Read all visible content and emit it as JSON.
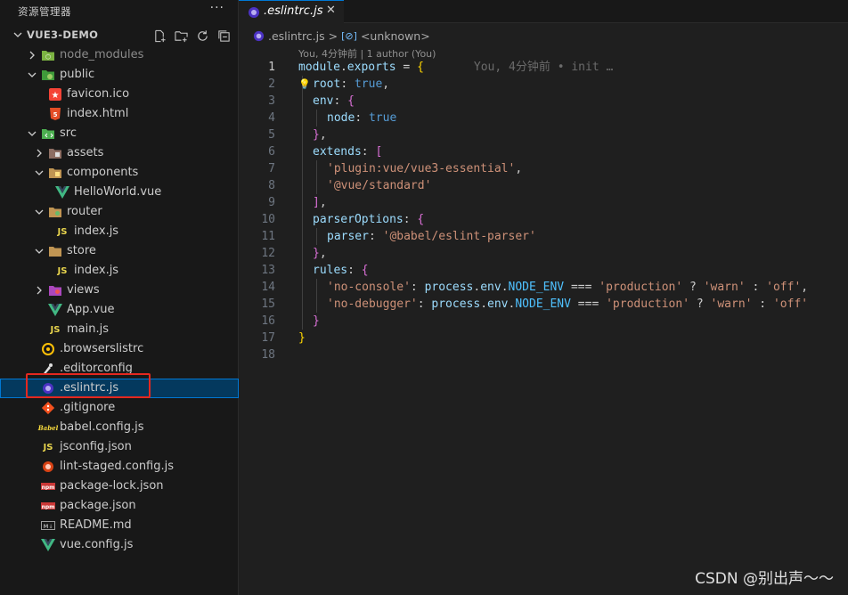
{
  "explorer": {
    "title": "资源管理器",
    "more": "···",
    "project": "VUE3-DEMO"
  },
  "tree": [
    {
      "label": "node_modules",
      "icon": "node-folder-icon",
      "level": 1,
      "chevron": "right",
      "dim": true
    },
    {
      "label": "public",
      "icon": "public-folder-icon",
      "level": 1,
      "chevron": "down"
    },
    {
      "label": "favicon.ico",
      "icon": "star-icon",
      "level": 2
    },
    {
      "label": "index.html",
      "icon": "html5-icon",
      "level": 2
    },
    {
      "label": "src",
      "icon": "src-folder-icon",
      "level": 1,
      "chevron": "down"
    },
    {
      "label": "assets",
      "icon": "assets-folder-icon",
      "level": 2,
      "chevron": "right"
    },
    {
      "label": "components",
      "icon": "components-folder-icon",
      "level": 2,
      "chevron": "down"
    },
    {
      "label": "HelloWorld.vue",
      "icon": "vue-icon",
      "level": 3
    },
    {
      "label": "router",
      "icon": "router-folder-icon",
      "level": 2,
      "chevron": "down"
    },
    {
      "label": "index.js",
      "icon": "js-icon",
      "level": 3
    },
    {
      "label": "store",
      "icon": "store-folder-icon",
      "level": 2,
      "chevron": "down"
    },
    {
      "label": "index.js",
      "icon": "js-icon",
      "level": 3
    },
    {
      "label": "views",
      "icon": "views-folder-icon",
      "level": 2,
      "chevron": "right"
    },
    {
      "label": "App.vue",
      "icon": "vue-icon",
      "level": 2
    },
    {
      "label": "main.js",
      "icon": "js-icon",
      "level": 2
    },
    {
      "label": ".browserslistrc",
      "icon": "browserslist-icon",
      "level": 1
    },
    {
      "label": ".editorconfig",
      "icon": "editorconfig-icon",
      "level": 1
    },
    {
      "label": ".eslintrc.js",
      "icon": "eslint-icon",
      "level": 1,
      "selected": true
    },
    {
      "label": ".gitignore",
      "icon": "git-icon",
      "level": 1
    },
    {
      "label": "babel.config.js",
      "icon": "babel-icon",
      "level": 1
    },
    {
      "label": "jsconfig.json",
      "icon": "js-icon",
      "level": 1
    },
    {
      "label": "lint-staged.config.js",
      "icon": "lint-staged-icon",
      "level": 1
    },
    {
      "label": "package-lock.json",
      "icon": "npm-icon",
      "level": 1
    },
    {
      "label": "package.json",
      "icon": "npm-icon",
      "level": 1
    },
    {
      "label": "README.md",
      "icon": "markdown-icon",
      "level": 1
    },
    {
      "label": "vue.config.js",
      "icon": "vue-config-icon",
      "level": 1
    }
  ],
  "tab": {
    "label": ".eslintrc.js",
    "close": "✕"
  },
  "breadcrumb": {
    "file": ".eslintrc.js",
    "sep": ">",
    "symbol": "<unknown>"
  },
  "codelens": "You, 4分钟前 | 1 author (You)",
  "blame": "You, 4分钟前 • init …",
  "line_numbers": [
    "1",
    "2",
    "3",
    "4",
    "5",
    "6",
    "7",
    "8",
    "9",
    "10",
    "11",
    "12",
    "13",
    "14",
    "15",
    "16",
    "17",
    "18"
  ],
  "active_line": "1",
  "code": [
    [
      [
        "k",
        "module"
      ],
      [
        "p",
        "."
      ],
      [
        "k",
        "exports"
      ],
      [
        "p",
        " = "
      ],
      [
        "b1",
        "{"
      ]
    ],
    [
      [
        "k",
        "root"
      ],
      [
        "p",
        ": "
      ],
      [
        "kw",
        "true"
      ],
      [
        "p",
        ","
      ]
    ],
    [
      [
        "k",
        "env"
      ],
      [
        "p",
        ": "
      ],
      [
        "b2",
        "{"
      ]
    ],
    [
      [
        "k",
        "node"
      ],
      [
        "p",
        ": "
      ],
      [
        "kw",
        "true"
      ]
    ],
    [
      [
        "b2",
        "}"
      ],
      [
        "p",
        ","
      ]
    ],
    [
      [
        "k",
        "extends"
      ],
      [
        "p",
        ": "
      ],
      [
        "b2",
        "["
      ]
    ],
    [
      [
        "s",
        "'plugin:vue/vue3-essential'"
      ],
      [
        "p",
        ","
      ]
    ],
    [
      [
        "s",
        "'@vue/standard'"
      ]
    ],
    [
      [
        "b2",
        "]"
      ],
      [
        "p",
        ","
      ]
    ],
    [
      [
        "k",
        "parserOptions"
      ],
      [
        "p",
        ": "
      ],
      [
        "b2",
        "{"
      ]
    ],
    [
      [
        "k",
        "parser"
      ],
      [
        "p",
        ": "
      ],
      [
        "s",
        "'@babel/eslint-parser'"
      ]
    ],
    [
      [
        "b2",
        "}"
      ],
      [
        "p",
        ","
      ]
    ],
    [
      [
        "k",
        "rules"
      ],
      [
        "p",
        ": "
      ],
      [
        "b2",
        "{"
      ]
    ],
    [
      [
        "s",
        "'no-console'"
      ],
      [
        "p",
        ": "
      ],
      [
        "k",
        "process"
      ],
      [
        "p",
        "."
      ],
      [
        "k",
        "env"
      ],
      [
        "p",
        "."
      ],
      [
        "fn",
        "NODE_ENV"
      ],
      [
        "p",
        " === "
      ],
      [
        "s",
        "'production'"
      ],
      [
        "p",
        " ? "
      ],
      [
        "s",
        "'warn'"
      ],
      [
        "p",
        " : "
      ],
      [
        "s",
        "'off'"
      ],
      [
        "p",
        ","
      ]
    ],
    [
      [
        "s",
        "'no-debugger'"
      ],
      [
        "p",
        ": "
      ],
      [
        "k",
        "process"
      ],
      [
        "p",
        "."
      ],
      [
        "k",
        "env"
      ],
      [
        "p",
        "."
      ],
      [
        "fn",
        "NODE_ENV"
      ],
      [
        "p",
        " === "
      ],
      [
        "s",
        "'production'"
      ],
      [
        "p",
        " ? "
      ],
      [
        "s",
        "'warn'"
      ],
      [
        "p",
        " : "
      ],
      [
        "s",
        "'off'"
      ]
    ],
    [
      [
        "b2",
        "}"
      ]
    ],
    [
      [
        "b1",
        "}"
      ]
    ],
    []
  ],
  "code_indent": [
    0,
    1,
    1,
    2,
    1,
    1,
    2,
    2,
    1,
    1,
    2,
    1,
    1,
    2,
    2,
    1,
    0,
    0
  ],
  "watermark": "CSDN @别出声～～"
}
